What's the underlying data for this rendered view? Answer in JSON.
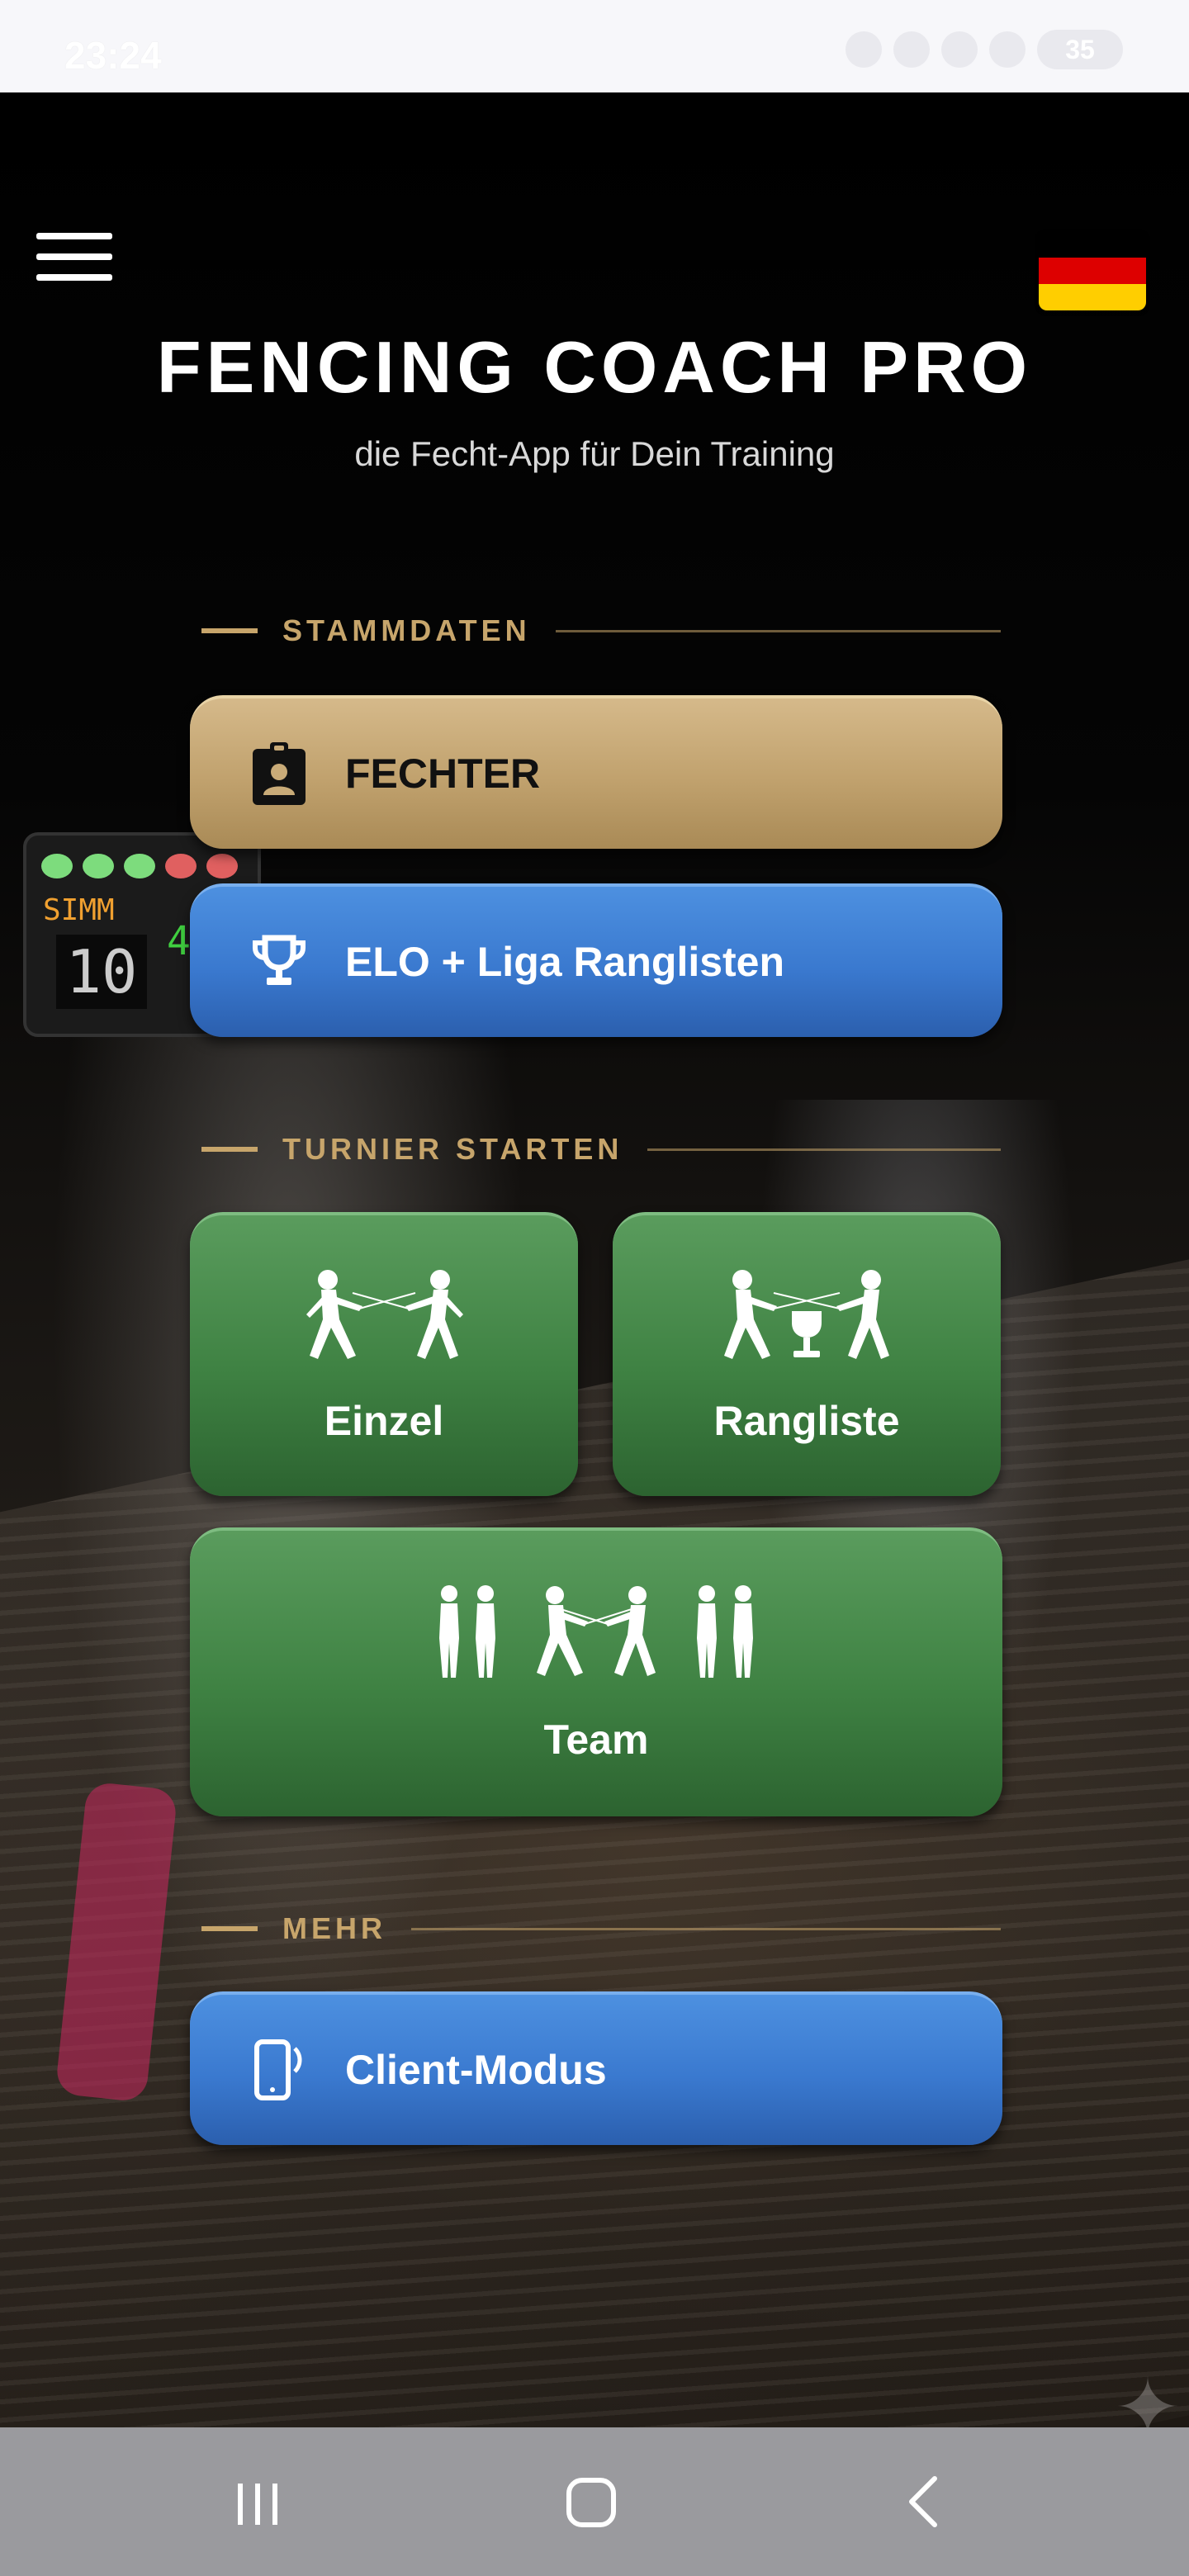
{
  "status_bar": {
    "time": "23:24",
    "battery": "35"
  },
  "header": {
    "title": "FENCING COACH PRO",
    "subtitle": "die Fecht-App für Dein Training"
  },
  "sections": {
    "stammdaten": "STAMMDATEN",
    "turnier": "TURNIER STARTEN",
    "mehr": "MEHR"
  },
  "buttons": {
    "fechter": "FECHTER",
    "elo": "ELO + Liga Ranglisten",
    "einzel": "Einzel",
    "rangliste": "Rangliste",
    "team": "Team",
    "client": "Client-Modus"
  },
  "background": {
    "board_left": "SIMM",
    "board_score": "10",
    "board_right": "4"
  },
  "colors": {
    "gold": "#c7a56b",
    "blue": "#3a79cf",
    "green": "#3f8243"
  },
  "icons": [
    "menu-icon",
    "german-flag-icon",
    "clipboard-person-icon",
    "trophy-icon",
    "fencers-icon",
    "fencers-trophy-icon",
    "team-fencers-icon",
    "phone-vibrate-icon",
    "recent-apps-icon",
    "home-icon",
    "back-icon",
    "sparkle-icon"
  ]
}
